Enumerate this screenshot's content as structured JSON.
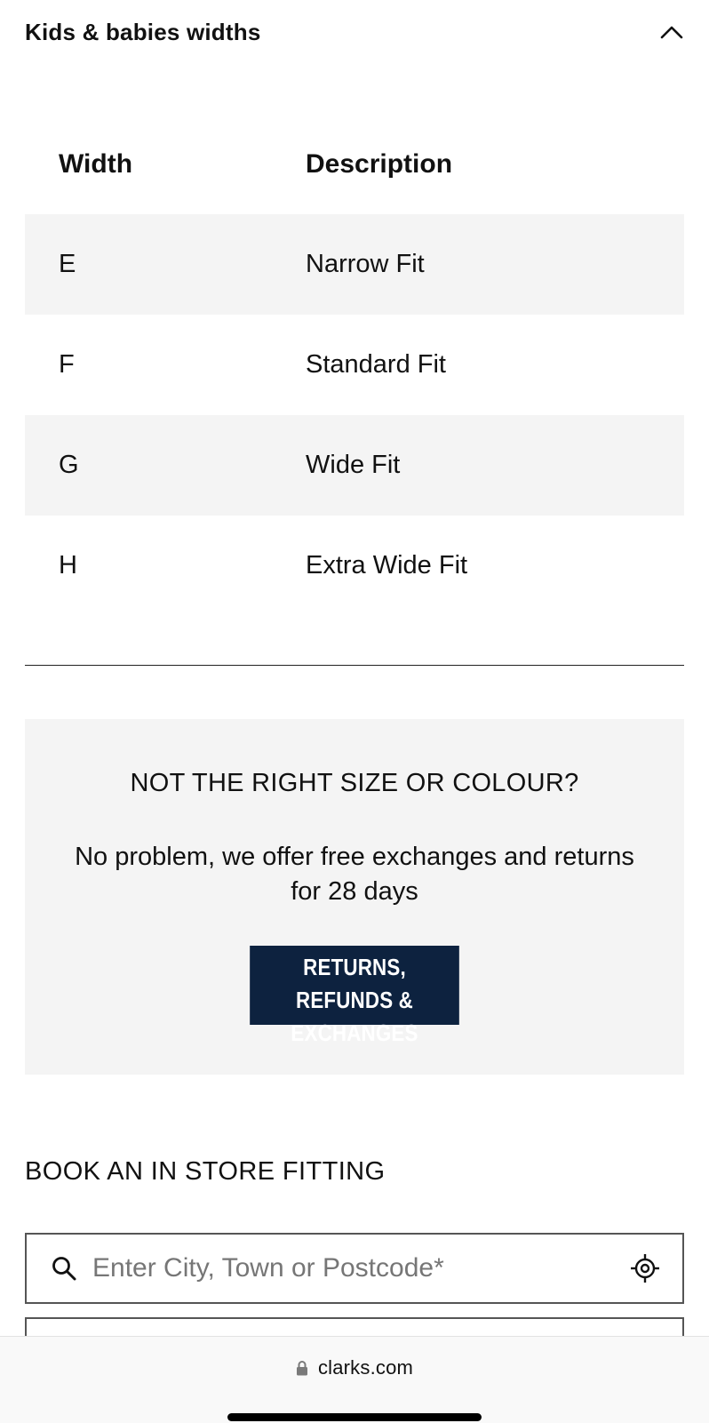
{
  "accordion": {
    "title": "Kids & babies widths",
    "icon": "chevron-up-icon"
  },
  "table": {
    "headers": {
      "width": "Width",
      "description": "Description"
    },
    "rows": [
      {
        "width": "E",
        "description": "Narrow Fit"
      },
      {
        "width": "F",
        "description": "Standard Fit"
      },
      {
        "width": "G",
        "description": "Wide Fit"
      },
      {
        "width": "H",
        "description": "Extra Wide Fit"
      }
    ]
  },
  "promo": {
    "heading": "NOT THE RIGHT SIZE OR COLOUR?",
    "text": "No problem, we offer free exchanges and returns for 28 days",
    "button_line1": "RETURNS, REFUNDS &",
    "button_line2": "EXCHANGES",
    "button_color": "#0d223f"
  },
  "fitting": {
    "title": "BOOK AN IN STORE FITTING",
    "search_placeholder": "Enter City, Town or Postcode*",
    "search_icon": "search-icon",
    "locate_icon": "locate-icon"
  },
  "browser": {
    "url": "clarks.com",
    "lock_icon": "lock-icon"
  }
}
